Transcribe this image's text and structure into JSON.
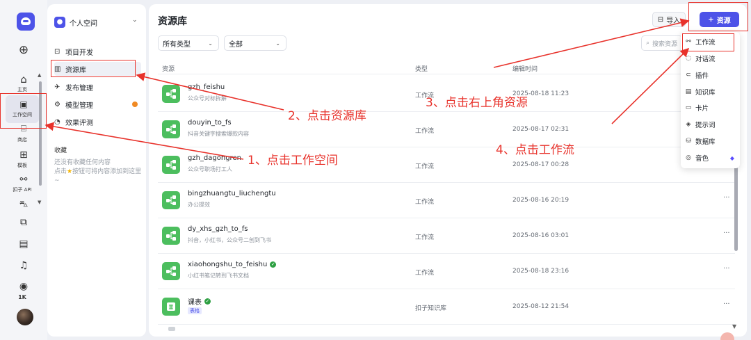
{
  "rail": {
    "items": [
      {
        "label": "主页",
        "icon": "home-icon"
      },
      {
        "label": "工作空间",
        "icon": "workspace-icon"
      },
      {
        "label": "商店",
        "icon": "store-icon"
      },
      {
        "label": "模板",
        "icon": "template-icon"
      },
      {
        "label": "扣子 API",
        "icon": "api-icon"
      }
    ],
    "points": "1K"
  },
  "sidebar": {
    "space_name": "个人空间",
    "nav": [
      {
        "label": "项目开发",
        "icon": "project-icon"
      },
      {
        "label": "资源库",
        "icon": "library-icon"
      },
      {
        "label": "发布管理",
        "icon": "publish-icon"
      },
      {
        "label": "模型管理",
        "icon": "model-icon"
      },
      {
        "label": "效果评测",
        "icon": "evaluation-icon"
      }
    ],
    "favorites_title": "收藏",
    "favorites_empty_1": "还没有收藏任何内容",
    "favorites_empty_2": "点击",
    "favorites_empty_3": "按钮可将内容添加到这里~"
  },
  "main": {
    "title": "资源库",
    "import_label": "导入",
    "add_resource_label": "资源",
    "type_filter": "所有类型",
    "scope_filter": "全部",
    "search_placeholder": "搜索资源",
    "columns": {
      "resource": "资源",
      "type": "类型",
      "edited": "编辑时间"
    },
    "rows": [
      {
        "name": "gzh_feishu",
        "desc": "公众号对标拆解",
        "type": "工作流",
        "time": "2025-08-18 11:23",
        "verified": false
      },
      {
        "name": "douyin_to_fs",
        "desc": "抖音关键字搜索爆款内容",
        "type": "工作流",
        "time": "2025-08-17 02:31",
        "verified": false
      },
      {
        "name": "gzh_dagongren",
        "desc": "公众号职场打工人",
        "type": "工作流",
        "time": "2025-08-17 00:28",
        "verified": false
      },
      {
        "name": "bingzhuangtu_liuchengtu",
        "desc": "办公提效",
        "type": "工作流",
        "time": "2025-08-16 20:19",
        "verified": false
      },
      {
        "name": "dy_xhs_gzh_to_fs",
        "desc": "抖音，小红书，公众号二创到飞书",
        "type": "工作流",
        "time": "2025-08-16 03:01",
        "verified": false
      },
      {
        "name": "xiaohongshu_to_feishu",
        "desc": "小红书笔记转到飞书文档",
        "type": "工作流",
        "time": "2025-08-18 23:16",
        "verified": true
      },
      {
        "name": "课表",
        "desc": "表格",
        "type": "扣子知识库",
        "time": "2025-08-12 21:54",
        "verified": true
      }
    ],
    "more_label": "···"
  },
  "dropdown": {
    "items": [
      {
        "label": "工作流",
        "icon": "workflow-icon"
      },
      {
        "label": "对话流",
        "icon": "chatflow-icon"
      },
      {
        "label": "插件",
        "icon": "plugin-icon"
      },
      {
        "label": "知识库",
        "icon": "knowledge-icon"
      },
      {
        "label": "卡片",
        "icon": "card-icon"
      },
      {
        "label": "提示词",
        "icon": "prompt-icon"
      },
      {
        "label": "数据库",
        "icon": "database-icon"
      },
      {
        "label": "音色",
        "icon": "voice-icon"
      }
    ]
  },
  "annotations": {
    "step1": "1、点击工作空间",
    "step2": "2、点击资源库",
    "step3": "3、点击右上角资源",
    "step4": "4、点击工作流"
  },
  "colors": {
    "accent": "#4d53e8",
    "annotation": "#e8322b",
    "workflow_icon": "#4cbe5e"
  }
}
